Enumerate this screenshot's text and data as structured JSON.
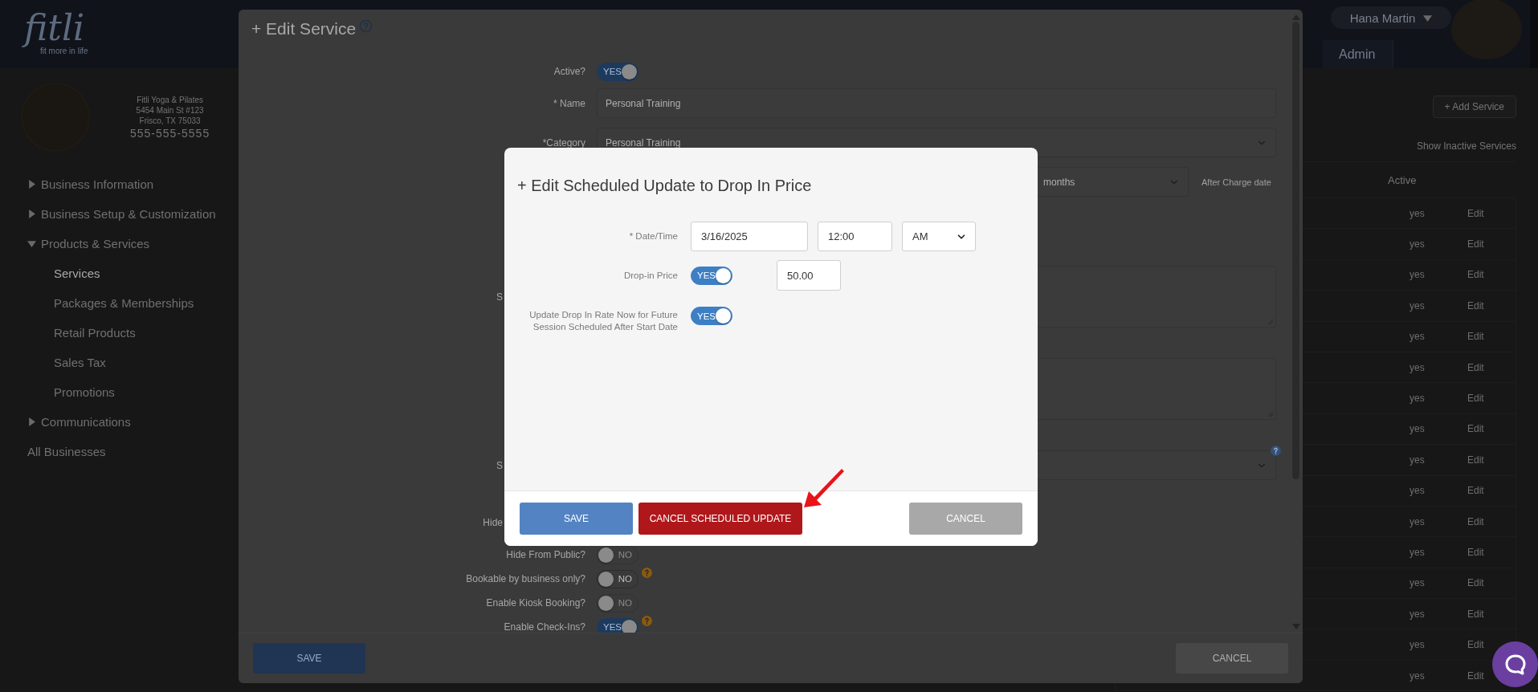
{
  "header": {
    "logo": "fitli",
    "tagline": "fit more in life",
    "user_menu": "Hana Martin",
    "nav_tab": "Admin"
  },
  "sidebar": {
    "business": {
      "name": "Fitli Yoga & Pilates",
      "address": "5454 Main St #123",
      "city": "Frisco, TX 75033",
      "phone": "555-555-5555"
    },
    "items": [
      {
        "kind": "group",
        "label": "Business Information",
        "expanded": false
      },
      {
        "kind": "group",
        "label": "Business Setup & Customization",
        "expanded": false
      },
      {
        "kind": "group",
        "label": "Products & Services",
        "expanded": true,
        "children": [
          {
            "label": "Services",
            "selected": true
          },
          {
            "label": "Packages & Memberships",
            "selected": false
          },
          {
            "label": "Retail Products",
            "selected": false
          },
          {
            "label": "Sales Tax",
            "selected": false
          },
          {
            "label": "Promotions",
            "selected": false
          }
        ]
      },
      {
        "kind": "group",
        "label": "Communications",
        "expanded": false
      },
      {
        "kind": "link",
        "label": "All Businesses"
      }
    ]
  },
  "services_table": {
    "add_button": "+ Add Service",
    "filter_link": "Show Inactive Services",
    "columns": [
      "Active"
    ],
    "rows": [
      {
        "active": "yes",
        "action": "Edit"
      },
      {
        "active": "yes",
        "action": "Edit"
      },
      {
        "active": "yes",
        "action": "Edit"
      },
      {
        "active": "yes",
        "action": "Edit"
      },
      {
        "active": "yes",
        "action": "Edit"
      },
      {
        "active": "yes",
        "action": "Edit"
      },
      {
        "active": "yes",
        "action": "Edit"
      },
      {
        "active": "yes",
        "action": "Edit"
      },
      {
        "active": "yes",
        "action": "Edit"
      },
      {
        "active": "yes",
        "action": "Edit"
      },
      {
        "active": "yes",
        "action": "Edit"
      },
      {
        "active": "yes",
        "action": "Edit"
      },
      {
        "active": "yes",
        "action": "Edit"
      },
      {
        "active": "yes",
        "action": "Edit"
      },
      {
        "active": "yes",
        "action": "Edit"
      },
      {
        "active": "yes",
        "action": "Edit"
      }
    ]
  },
  "edit_service": {
    "title": "+ Edit Service",
    "fields": [
      {
        "kind": "toggle",
        "label": "Active?",
        "on": true,
        "state_label": "YES"
      },
      {
        "kind": "input",
        "label": "* Name",
        "value": "Personal Training"
      },
      {
        "kind": "select",
        "label": "*Category",
        "value": "Personal Training"
      },
      {
        "kind": "select_note",
        "value": "months",
        "note": "After Charge date"
      },
      {
        "kind": "textarea",
        "label": "S"
      },
      {
        "kind": "textarea"
      },
      {
        "kind": "select",
        "label": "S",
        "help": true
      },
      {
        "kind": "label_only",
        "label": "Hide"
      },
      {
        "kind": "toggle",
        "label": "Hide From Public?",
        "on": false,
        "state_label": "NO",
        "disabled": true
      },
      {
        "kind": "toggle",
        "label": "Bookable by business only?",
        "on": false,
        "state_label": "NO",
        "help": true
      },
      {
        "kind": "toggle",
        "label": "Enable Kiosk Booking?",
        "on": false,
        "state_label": "NO",
        "disabled": true
      },
      {
        "kind": "toggle",
        "label": "Enable Check-Ins?",
        "on": true,
        "state_label": "YES",
        "help": true
      }
    ],
    "buttons": [
      {
        "kind": "primary",
        "label": "SAVE"
      },
      {
        "kind": "secondary",
        "label": "CANCEL"
      }
    ]
  },
  "schedule_dialog": {
    "title": "+ Edit Scheduled Update to Drop In Price",
    "fields": [
      {
        "kind": "datetime",
        "label": "* Date/Time",
        "date": "3/16/2025",
        "time": "12:00",
        "period": "AM"
      },
      {
        "kind": "toggle_value",
        "label": "Drop-in Price",
        "on": true,
        "state_label": "YES",
        "value": "50.00"
      },
      {
        "kind": "toggle",
        "label": "Update Drop In Rate Now for Future Session Scheduled After Start Date",
        "on": true,
        "state_label": "YES"
      }
    ],
    "buttons": [
      {
        "kind": "primary",
        "label": "SAVE"
      },
      {
        "kind": "danger",
        "label": "CANCEL SCHEDULED UPDATE"
      },
      {
        "kind": "secondary",
        "label": "CANCEL"
      }
    ]
  }
}
